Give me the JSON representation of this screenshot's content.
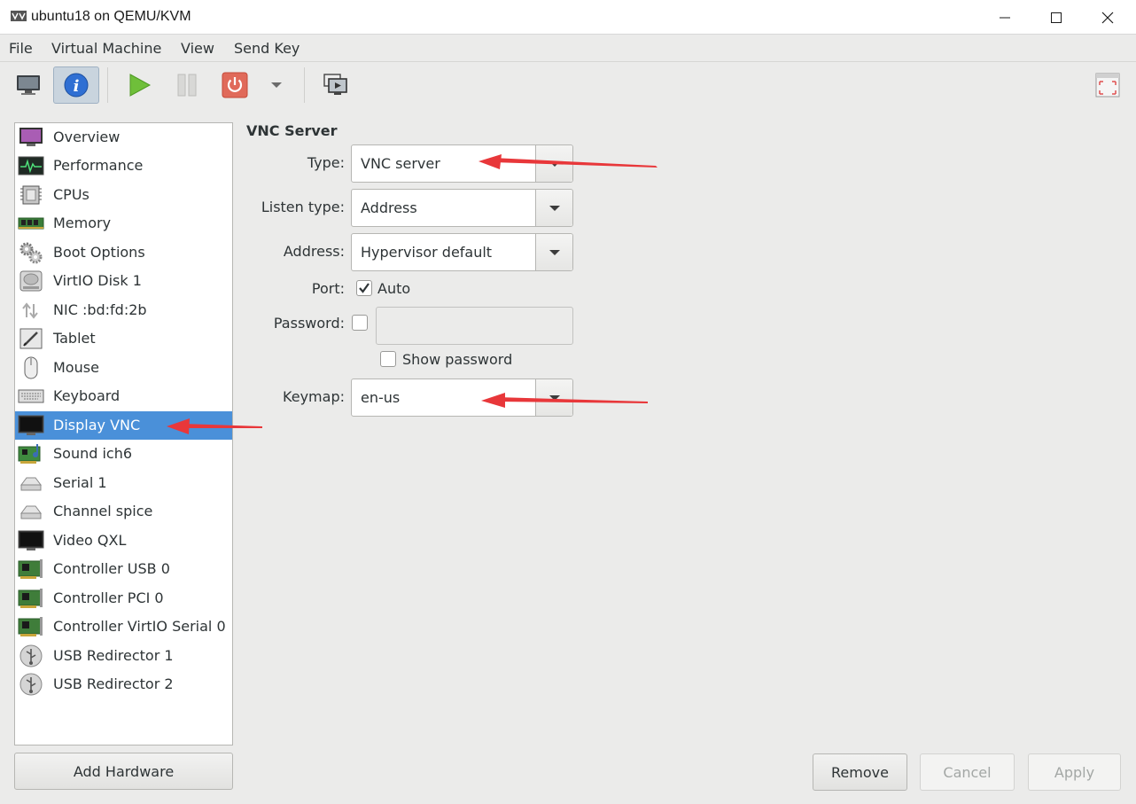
{
  "window": {
    "title": "ubuntu18 on QEMU/KVM",
    "controls": [
      "minimize",
      "maximize",
      "close"
    ]
  },
  "menubar": {
    "items": [
      {
        "label": "File"
      },
      {
        "label": "Virtual Machine"
      },
      {
        "label": "View"
      },
      {
        "label": "Send Key"
      }
    ]
  },
  "toolbar": {
    "buttons": [
      {
        "name": "console",
        "icon": "monitor-icon"
      },
      {
        "name": "details",
        "icon": "info-icon",
        "active": true
      },
      {
        "name": "run",
        "icon": "play-icon"
      },
      {
        "name": "pause",
        "icon": "pause-icon"
      },
      {
        "name": "shutdown",
        "icon": "power-icon"
      },
      {
        "name": "shutdown-menu",
        "icon": "chevron-down-icon"
      },
      {
        "name": "snapshots",
        "icon": "snapshot-icon"
      },
      {
        "name": "fullscreen",
        "icon": "fullscreen-icon"
      }
    ]
  },
  "sidebar": {
    "items": [
      {
        "label": "Overview",
        "icon": "overview-monitor-icon"
      },
      {
        "label": "Performance",
        "icon": "performance-graph-icon"
      },
      {
        "label": "CPUs",
        "icon": "cpu-chip-icon"
      },
      {
        "label": "Memory",
        "icon": "memory-ram-icon"
      },
      {
        "label": "Boot Options",
        "icon": "gears-icon"
      },
      {
        "label": "VirtIO Disk 1",
        "icon": "hard-disk-icon"
      },
      {
        "label": "NIC :bd:fd:2b",
        "icon": "network-arrows-icon"
      },
      {
        "label": "Tablet",
        "icon": "tablet-icon"
      },
      {
        "label": "Mouse",
        "icon": "mouse-icon"
      },
      {
        "label": "Keyboard",
        "icon": "keyboard-icon"
      },
      {
        "label": "Display VNC",
        "icon": "display-monitor-icon",
        "selected": true
      },
      {
        "label": "Sound ich6",
        "icon": "sound-card-icon"
      },
      {
        "label": "Serial 1",
        "icon": "serial-port-icon"
      },
      {
        "label": "Channel spice",
        "icon": "channel-port-icon"
      },
      {
        "label": "Video QXL",
        "icon": "video-monitor-icon"
      },
      {
        "label": "Controller USB 0",
        "icon": "controller-card-icon"
      },
      {
        "label": "Controller PCI 0",
        "icon": "controller-card-icon"
      },
      {
        "label": "Controller VirtIO Serial 0",
        "icon": "controller-card-icon"
      },
      {
        "label": "USB Redirector 1",
        "icon": "usb-icon"
      },
      {
        "label": "USB Redirector 2",
        "icon": "usb-icon"
      }
    ],
    "add_hardware_label": "Add Hardware"
  },
  "details": {
    "section_title": "VNC Server",
    "type": {
      "label": "Type:",
      "value": "VNC server"
    },
    "listen_type": {
      "label": "Listen type:",
      "value": "Address"
    },
    "address": {
      "label": "Address:",
      "value": "Hypervisor default"
    },
    "port": {
      "label": "Port:",
      "auto_label": "Auto",
      "auto_checked": true
    },
    "password": {
      "label": "Password:",
      "enabled": false,
      "value": "",
      "show_password_label": "Show password",
      "show_password_checked": false
    },
    "keymap": {
      "label": "Keymap:",
      "value": "en-us"
    }
  },
  "actions": {
    "remove_label": "Remove",
    "cancel_label": "Cancel",
    "apply_label": "Apply"
  },
  "colors": {
    "selection": "#4a90d9",
    "annotation_arrow": "#e8373a"
  }
}
